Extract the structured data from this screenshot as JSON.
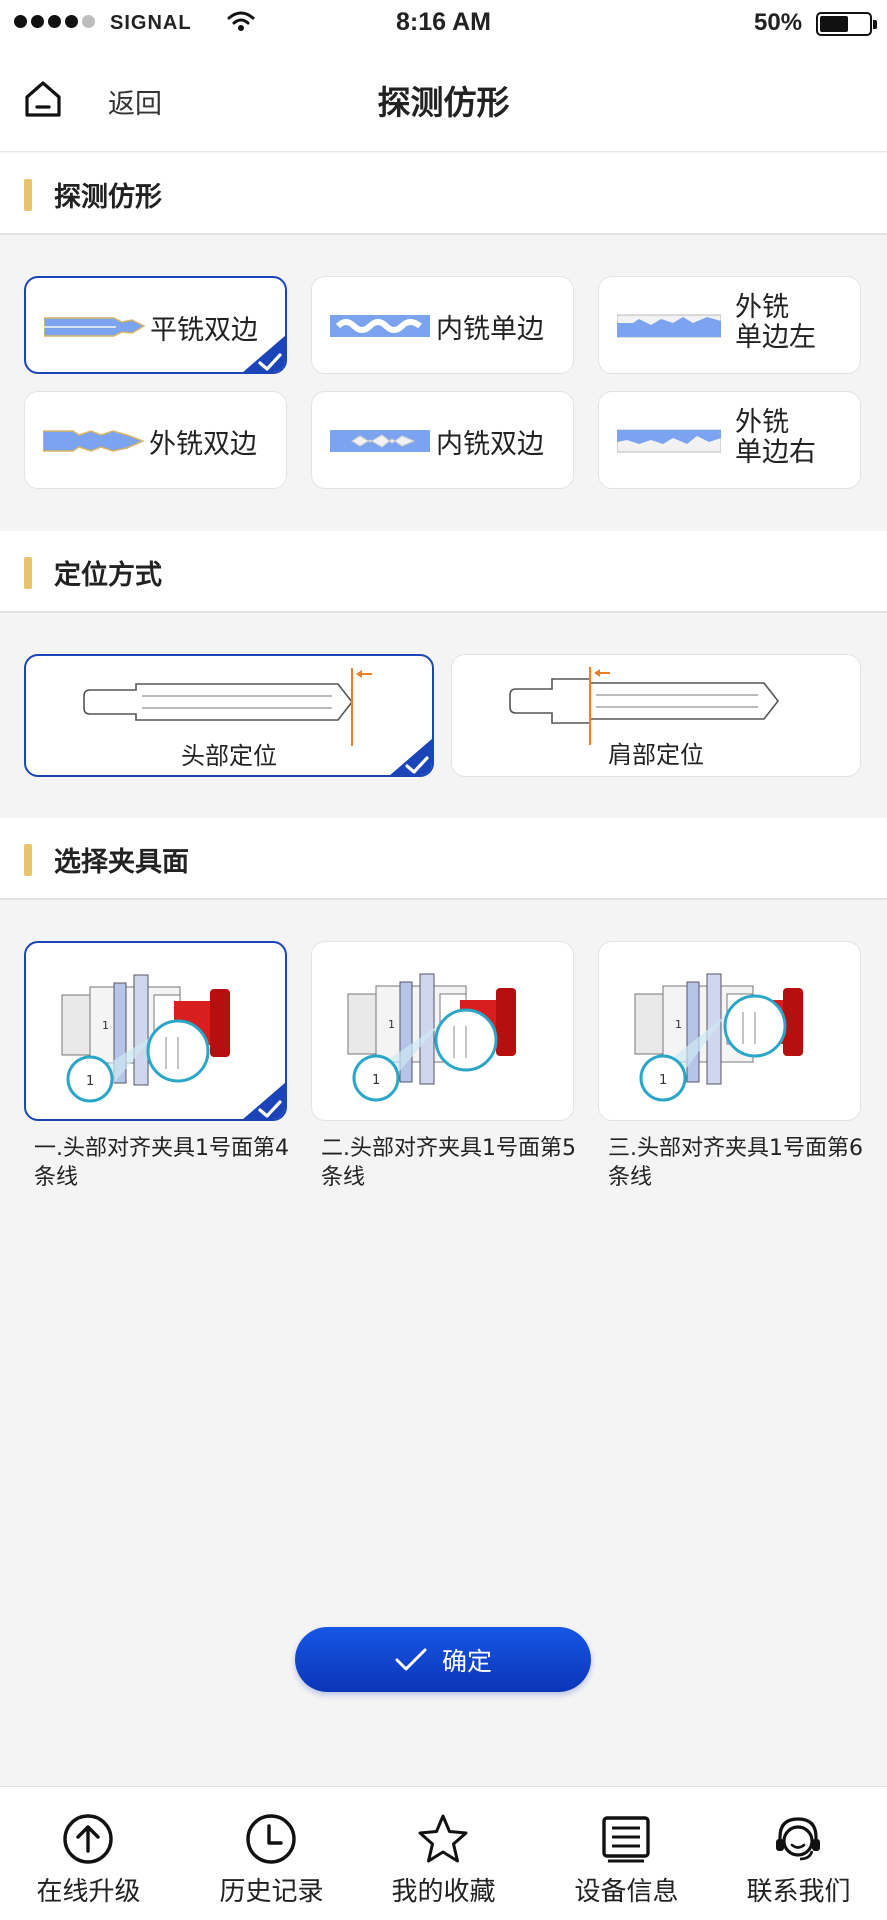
{
  "status_bar": {
    "carrier": "SIGNAL",
    "time": "8:16 AM",
    "battery": "50%"
  },
  "header": {
    "back_label": "返回",
    "title": "探测仿形"
  },
  "section_key_type": {
    "title": "探测仿形",
    "options": [
      {
        "label": "平铣双边",
        "selected": true
      },
      {
        "label": "内铣单边",
        "selected": false
      },
      {
        "label": "外铣单边左",
        "line1": "外铣",
        "line2": "单边左",
        "selected": false
      },
      {
        "label": "外铣双边",
        "selected": false
      },
      {
        "label": "内铣双边",
        "selected": false
      },
      {
        "label": "外铣单边右",
        "line1": "外铣",
        "line2": "单边右",
        "selected": false
      }
    ]
  },
  "section_position": {
    "title": "定位方式",
    "options": [
      {
        "label": "头部定位",
        "selected": true
      },
      {
        "label": "肩部定位",
        "selected": false
      }
    ]
  },
  "section_clamp": {
    "title": "选择夹具面",
    "options": [
      {
        "caption": "一.头部对齐夹具1号面第4条线",
        "selected": true
      },
      {
        "caption": "二.头部对齐夹具1号面第5条线",
        "selected": false
      },
      {
        "caption": "三.头部对齐夹具1号面第6条线",
        "selected": false
      }
    ]
  },
  "confirm_label": "确定",
  "bottom_nav": [
    {
      "label": "在线升级",
      "icon": "upgrade-arrow-icon"
    },
    {
      "label": "历史记录",
      "icon": "clock-icon"
    },
    {
      "label": "我的收藏",
      "icon": "star-icon"
    },
    {
      "label": "设备信息",
      "icon": "list-icon"
    },
    {
      "label": "联系我们",
      "icon": "headset-icon"
    }
  ],
  "colors": {
    "accent_blue": "#1a44b8",
    "section_bar": "#e7c36b",
    "clamp_red": "#d81e1e"
  }
}
